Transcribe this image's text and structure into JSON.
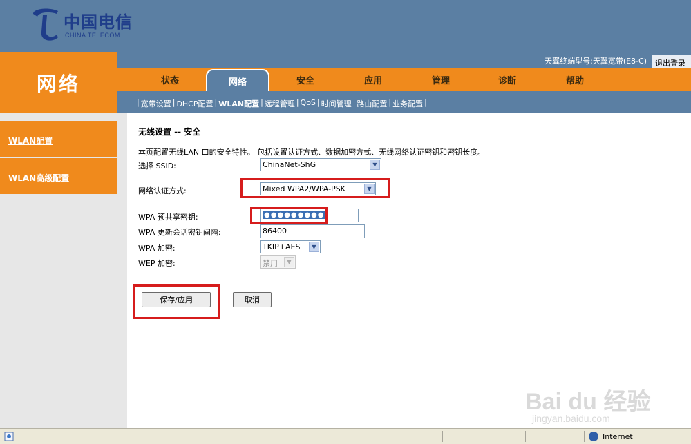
{
  "brand": {
    "logo_cn": "中国电信",
    "logo_en": "CHINA TELECOM",
    "colors": {
      "header": "#5b7fa3",
      "accent": "#f08a1c",
      "highlight": "#d61c1c"
    }
  },
  "section_title": "网络",
  "device_info": "天翼终端型号:天翼宽带(E8-C)",
  "logout_label": "退出登录",
  "tabs": [
    {
      "label": "状态"
    },
    {
      "label": "网络"
    },
    {
      "label": "安全"
    },
    {
      "label": "应用"
    },
    {
      "label": "管理"
    },
    {
      "label": "诊断"
    },
    {
      "label": "帮助"
    }
  ],
  "active_tab": "网络",
  "subnav": [
    {
      "label": "宽带设置"
    },
    {
      "label": "DHCP配置"
    },
    {
      "label": "WLAN配置"
    },
    {
      "label": "远程管理"
    },
    {
      "label": "QoS"
    },
    {
      "label": "时间管理"
    },
    {
      "label": "路由配置"
    },
    {
      "label": "业务配置"
    }
  ],
  "subnav_separator": "|",
  "sidebar": [
    {
      "label": "WLAN配置"
    },
    {
      "label": "WLAN高级配置"
    }
  ],
  "content": {
    "title": "无线设置 -- 安全",
    "description": "本页配置无线LAN 口的安全特性。 包括设置认证方式、数据加密方式、无线网络认证密钥和密钥长度。",
    "fields": {
      "ssid_label": "选择 SSID:",
      "ssid_value": "ChinaNet-ShG",
      "auth_label": "网络认证方式:",
      "auth_value": "Mixed WPA2/WPA-PSK",
      "psk_label": "WPA 预共享密钥:",
      "psk_value": "●●●●●●●●●",
      "rekey_label": "WPA 更新会话密钥间隔:",
      "rekey_value": "86400",
      "wpa_enc_label": "WPA 加密:",
      "wpa_enc_value": "TKIP+AES",
      "wep_enc_label": "WEP 加密:",
      "wep_enc_value": "禁用"
    },
    "buttons": {
      "save": "保存/应用",
      "cancel": "取消"
    }
  },
  "watermark": {
    "brand": "Bai du 经验",
    "url": "jingyan.baidu.com"
  },
  "statusbar": {
    "zone": "Internet",
    "icons": [
      "page-icon",
      "globe-icon"
    ]
  }
}
